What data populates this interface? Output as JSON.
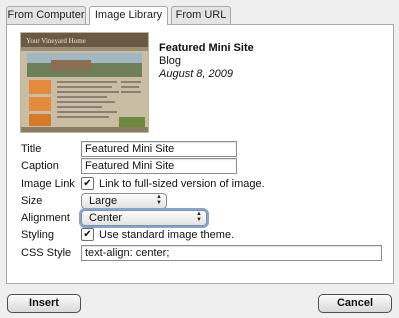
{
  "tabs": [
    {
      "label": "From Computer",
      "active": false
    },
    {
      "label": "Image Library",
      "active": true
    },
    {
      "label": "From URL",
      "active": false
    }
  ],
  "image": {
    "title": "Featured Mini Site",
    "category": "Blog",
    "date": "August 8, 2009",
    "preview_header": "Your Vineyard Home"
  },
  "form": {
    "title_label": "Title",
    "title_value": "Featured Mini Site",
    "caption_label": "Caption",
    "caption_value": "Featured Mini Site",
    "image_link_label": "Image Link",
    "image_link_checked": true,
    "image_link_text": "Link to full-sized version of image.",
    "size_label": "Size",
    "size_value": "Large",
    "alignment_label": "Alignment",
    "alignment_value": "Center",
    "styling_label": "Styling",
    "styling_checked": true,
    "styling_text": "Use standard image theme.",
    "css_label": "CSS Style",
    "css_value": "text-align: center;"
  },
  "buttons": {
    "insert": "Insert",
    "cancel": "Cancel"
  },
  "icons": {
    "checkmark": "✔",
    "select_arrows": "updown-chevron-icon"
  }
}
